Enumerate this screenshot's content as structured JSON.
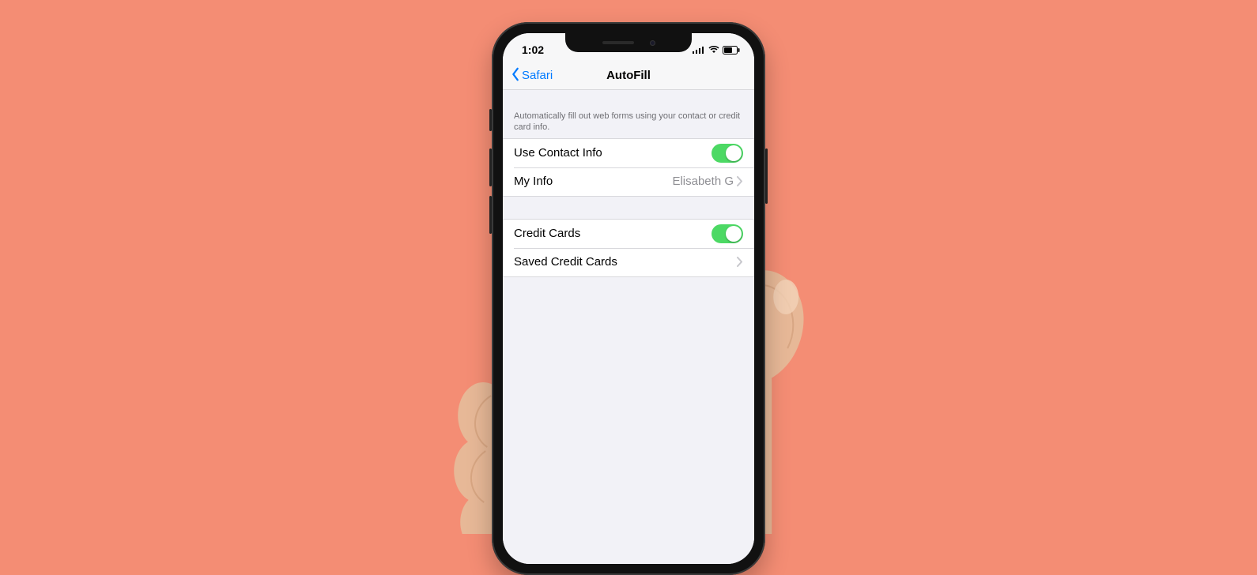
{
  "statusbar": {
    "time": "1:02"
  },
  "navbar": {
    "back_label": "Safari",
    "title": "AutoFill"
  },
  "section_description": "Automatically fill out web forms using your contact or credit card info.",
  "contact_group": {
    "use_contact_info_label": "Use Contact Info",
    "use_contact_info_on": true,
    "my_info_label": "My Info",
    "my_info_value": "Elisabeth G"
  },
  "cards_group": {
    "credit_cards_label": "Credit Cards",
    "credit_cards_on": true,
    "saved_credit_cards_label": "Saved Credit Cards"
  }
}
